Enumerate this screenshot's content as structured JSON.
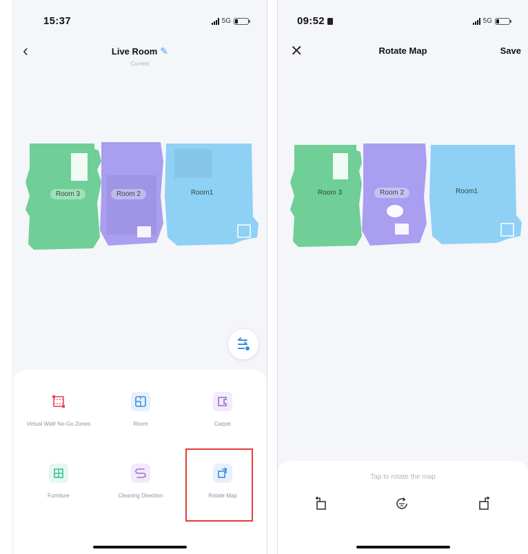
{
  "left_screen": {
    "status": {
      "time": "15:37",
      "network": "5G"
    },
    "header": {
      "title": "Live Room",
      "subtitle": "Current"
    },
    "rooms": [
      "Room 3",
      "Room 2",
      "Room1"
    ],
    "tools": [
      {
        "label": "Virtual Wall/ No-Go Zones",
        "icon": "virtual-wall-icon",
        "color": "#e8485c"
      },
      {
        "label": "Room",
        "icon": "room-edit-icon",
        "color": "#3c8be0"
      },
      {
        "label": "Carpet",
        "icon": "carpet-icon",
        "color": "#9b6ad8"
      },
      {
        "label": "Furniture",
        "icon": "furniture-icon",
        "color": "#3dbf96"
      },
      {
        "label": "Cleaning Direction",
        "icon": "cleaning-direction-icon",
        "color": "#a86ad8"
      },
      {
        "label": "Rotate Map",
        "icon": "rotate-map-icon",
        "color": "#3c8be0",
        "selected": true
      }
    ]
  },
  "right_screen": {
    "status": {
      "time": "09:52",
      "network": "5G"
    },
    "header": {
      "title": "Rotate Map",
      "save_label": "Save"
    },
    "rooms": [
      "Room 3",
      "Room 2",
      "Room1"
    ],
    "rotate_hint": "Tap to rotate the map"
  },
  "colors": {
    "room_green": "#6fcf97",
    "room_purple": "#a99ef0",
    "room_blue": "#8fd0f5",
    "accent": "#4a9ff5",
    "highlight": "#e53935"
  }
}
